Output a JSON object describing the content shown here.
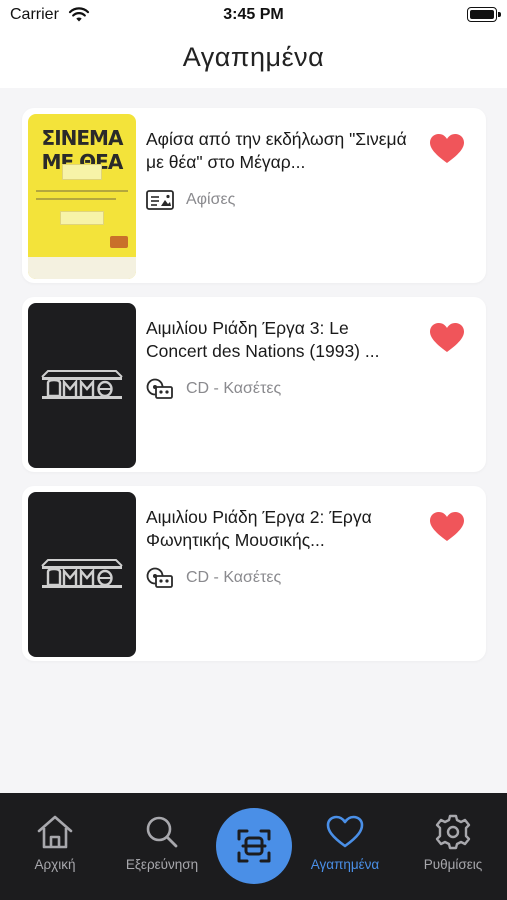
{
  "status_bar": {
    "carrier": "Carrier",
    "time": "3:45 PM"
  },
  "header": {
    "title": "Αγαπημένα"
  },
  "favorites": [
    {
      "title": "Αφίσα από την εκδήλωση \"Σινεμά με θέα\" στο Μέγαρ...",
      "category": "Αφίσες",
      "category_icon": "poster-icon",
      "thumbnail": {
        "type": "poster",
        "text": "ΣΙΝΕΜΑ ΜΕ ΘΕΑ"
      },
      "favorited": true
    },
    {
      "title": "Αιμιλίου Ριάδη Έργα 3: Le Concert des Nations (1993) ...",
      "category": "CD - Κασέτες",
      "category_icon": "cd-cassette-icon",
      "thumbnail": {
        "type": "logo"
      },
      "favorited": true
    },
    {
      "title": "Αιμιλίου Ριάδη Έργα 2: Έργα Φωνητικής Μουσικής...",
      "category": "CD - Κασέτες",
      "category_icon": "cd-cassette-icon",
      "thumbnail": {
        "type": "logo"
      },
      "favorited": true
    }
  ],
  "tab_bar": {
    "tabs": [
      {
        "label": "Αρχική",
        "icon": "home-icon",
        "active": false
      },
      {
        "label": "Εξερεύνηση",
        "icon": "search-icon",
        "active": false
      },
      {
        "label": "Αγαπημένα",
        "icon": "heart-icon",
        "active": true
      },
      {
        "label": "Ρυθμίσεις",
        "icon": "gear-icon",
        "active": false
      }
    ],
    "scan_icon": "scan-icon"
  },
  "colors": {
    "accent": "#4a8fe7",
    "heart": "#f0555a",
    "tab_bar_bg": "#1c1c1e",
    "background": "#f5f5f7",
    "poster_yellow": "#f3e33a",
    "muted_text": "#8a8a8e"
  }
}
